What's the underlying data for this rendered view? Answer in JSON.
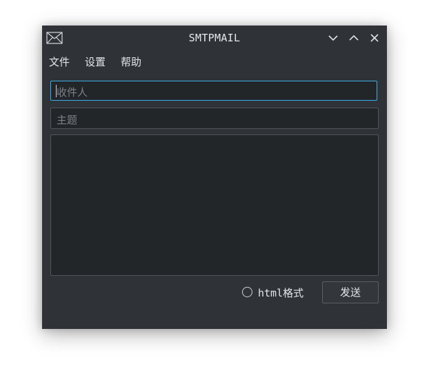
{
  "window": {
    "title": "SMTPMAIL",
    "icons": [
      "mail-icon",
      "minimize-icon",
      "maximize-icon",
      "close-icon"
    ]
  },
  "menu": {
    "items": [
      {
        "label": "文件"
      },
      {
        "label": "设置"
      },
      {
        "label": "帮助"
      }
    ]
  },
  "form": {
    "recipient_placeholder": "收件人",
    "subject_placeholder": "主题",
    "body_value": ""
  },
  "footer": {
    "html_format_prefix": "html",
    "html_format_suffix": "格式",
    "html_format_checked": false,
    "send_label": "发送"
  },
  "colors": {
    "window_bg": "#2f3338",
    "field_bg": "#232629",
    "focus_border": "#3daee9",
    "text": "#e4e6e8"
  }
}
